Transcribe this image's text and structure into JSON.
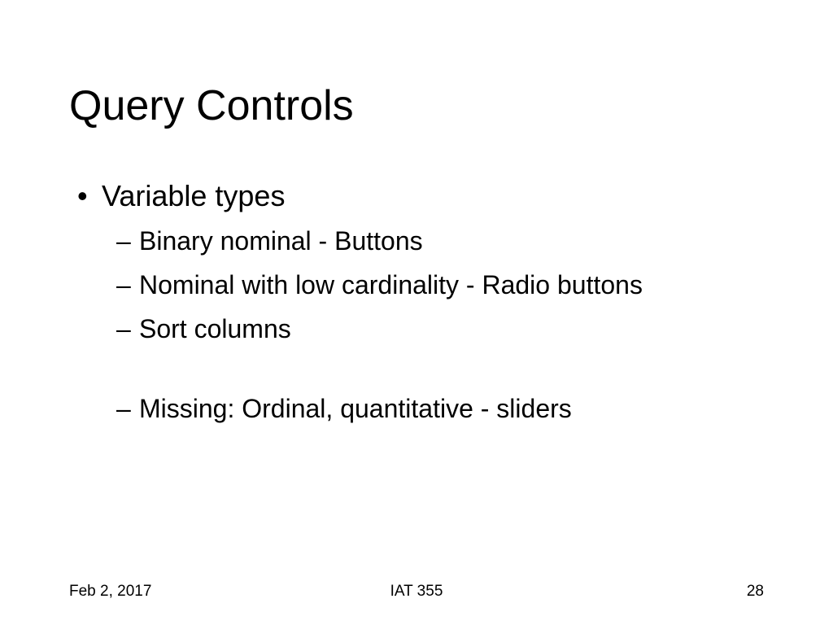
{
  "slide": {
    "title": "Query Controls",
    "bullets": {
      "level1": "Variable types",
      "sub1": "Binary nominal - Buttons",
      "sub2": "Nominal with low cardinality - Radio buttons",
      "sub3": "Sort columns",
      "sub4": "Missing: Ordinal, quantitative - sliders"
    },
    "footer": {
      "date": "Feb 2, 2017",
      "course": "IAT 355",
      "page": "28"
    }
  }
}
